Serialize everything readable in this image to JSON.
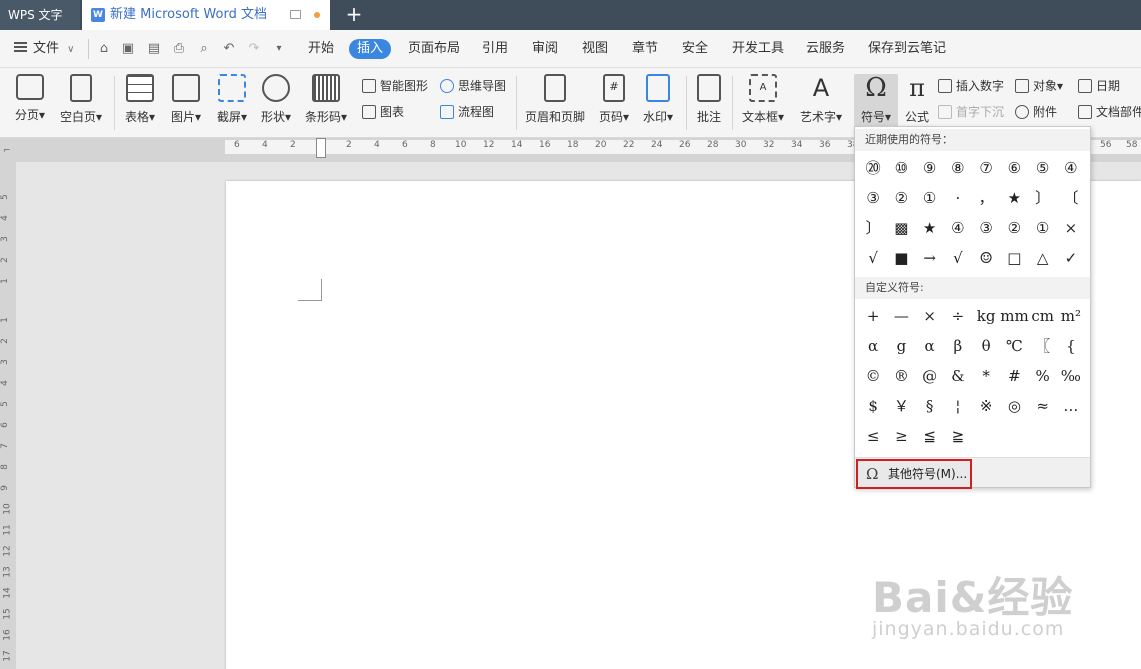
{
  "title_bar": {
    "app_tab": "WPS 文字",
    "doc_tab": "新建 Microsoft Word 文档",
    "add_tab": "+"
  },
  "menu_bar": {
    "file": "文件",
    "items": [
      "开始",
      "插入",
      "页面布局",
      "引用",
      "审阅",
      "视图",
      "章节",
      "安全",
      "开发工具",
      "云服务",
      "保存到云笔记"
    ],
    "active": "插入"
  },
  "ribbon": {
    "page_break": "分页",
    "blank_page": "空白页",
    "table": "表格",
    "picture": "图片",
    "screenshot": "截屏",
    "shape": "形状",
    "barcode": "条形码",
    "smart_art": "智能图形",
    "mind_map": "思维导图",
    "chart": "图表",
    "flowchart": "流程图",
    "header_footer": "页眉和页脚",
    "page_number": "页码",
    "watermark": "水印",
    "comment": "批注",
    "text_box": "文本框",
    "word_art": "艺术字",
    "symbol": "符号",
    "formula": "公式",
    "insert_number": "插入数字",
    "drop_cap": "首字下沉",
    "object": "对象",
    "attachment": "附件",
    "date": "日期",
    "doc_parts": "文档部件"
  },
  "ruler": {
    "h_ticks": [
      "6",
      "4",
      "2",
      "2",
      "4",
      "6",
      "8",
      "10",
      "12",
      "14",
      "16",
      "18",
      "20",
      "22",
      "24",
      "26",
      "28",
      "30",
      "32",
      "34",
      "36",
      "38",
      "56",
      "58"
    ],
    "v_ticks": [
      "5",
      "4",
      "3",
      "2",
      "1",
      "1",
      "2",
      "3",
      "4",
      "5",
      "6",
      "7",
      "8",
      "9",
      "10",
      "11",
      "12",
      "13",
      "14",
      "15",
      "16",
      "17"
    ]
  },
  "symbol_panel": {
    "recent_title": "近期使用的符号：",
    "recent": [
      "⑳",
      "⑩",
      "⑨",
      "⑧",
      "⑦",
      "⑥",
      "⑤",
      "④",
      "③",
      "②",
      "①",
      "·",
      "，",
      "★",
      "〕",
      "〔",
      "〕",
      "▩",
      "★",
      "④",
      "③",
      "②",
      "①",
      "×",
      "√",
      "■",
      "→",
      "√",
      "☺",
      "□",
      "△",
      "✓"
    ],
    "custom_title": "自定义符号:",
    "custom": [
      "+",
      "—",
      "×",
      "÷",
      "kg",
      "mm",
      "cm",
      "m²",
      "α",
      "g",
      "α",
      "β",
      "θ",
      "℃",
      "〖",
      "{",
      "©",
      "®",
      "@",
      "&",
      "*",
      "#",
      "%",
      "‰",
      "$",
      "￥",
      "§",
      "¦",
      "※",
      "◎",
      "≈",
      "…",
      "≤",
      "≥",
      "≦",
      "≧"
    ],
    "more_label": "其他符号(M)...",
    "more_icon": "omega-icon"
  },
  "watermark": {
    "line1": "Bai&经验",
    "line2": "jingyan.baidu.com"
  }
}
